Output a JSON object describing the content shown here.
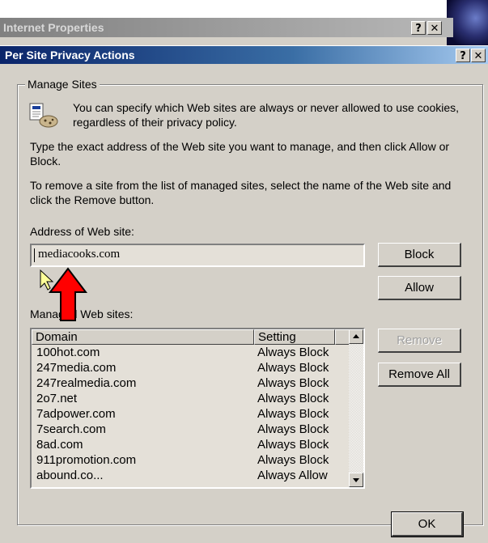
{
  "background_window": {
    "title": "Internet Properties",
    "help_glyph": "?",
    "close_glyph": "✕"
  },
  "dialog": {
    "title": "Per Site Privacy Actions",
    "help_glyph": "?",
    "close_glyph": "✕",
    "group_label": "Manage Sites",
    "intro": "You can specify which Web sites are always or never allowed to use cookies, regardless of their privacy policy.",
    "instruction_1": "Type the exact address of the Web site you want to manage, and then click Allow or Block.",
    "instruction_2": "To remove a site from the list of managed sites, select the name of the Web site and click the Remove button.",
    "address_label": "Address of Web site:",
    "address_value": "mediacooks.com",
    "managed_label": "Managed Web sites:",
    "buttons": {
      "block": "Block",
      "allow": "Allow",
      "remove": "Remove",
      "remove_all": "Remove All",
      "ok": "OK"
    },
    "list": {
      "columns": [
        "Domain",
        "Setting"
      ],
      "rows": [
        {
          "domain": "100hot.com",
          "setting": "Always Block"
        },
        {
          "domain": "247media.com",
          "setting": "Always Block"
        },
        {
          "domain": "247realmedia.com",
          "setting": "Always Block"
        },
        {
          "domain": "2o7.net",
          "setting": "Always Block"
        },
        {
          "domain": "7adpower.com",
          "setting": "Always Block"
        },
        {
          "domain": "7search.com",
          "setting": "Always Block"
        },
        {
          "domain": "8ad.com",
          "setting": "Always Block"
        },
        {
          "domain": "911promotion.com",
          "setting": "Always Block"
        },
        {
          "domain": "abound.co...",
          "setting": "Always Allow"
        }
      ]
    }
  }
}
